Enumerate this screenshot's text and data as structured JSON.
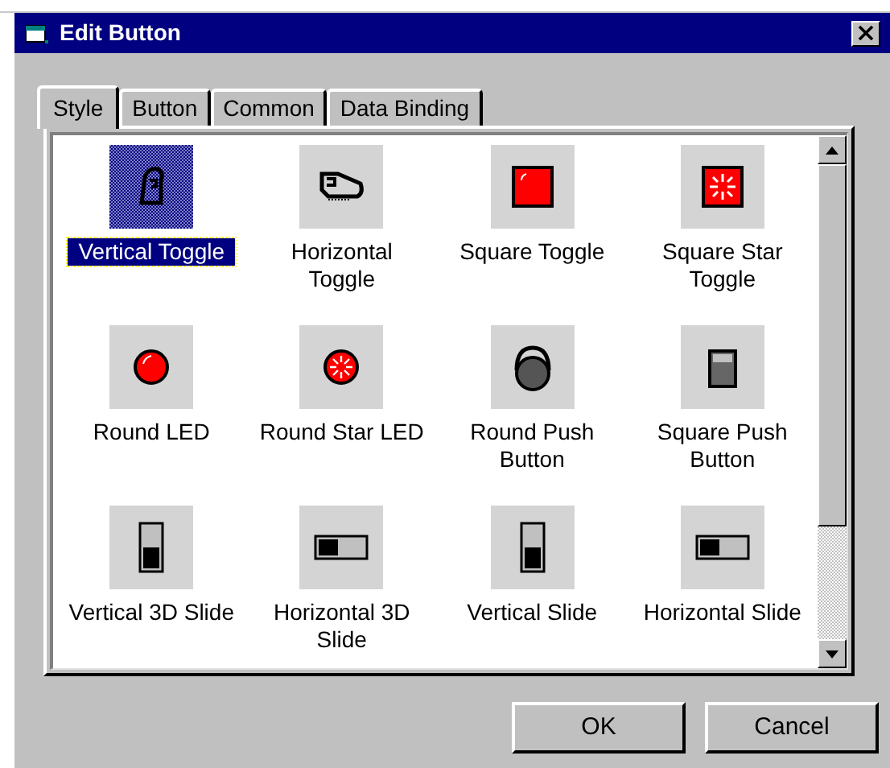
{
  "window": {
    "title": "Edit Button"
  },
  "tabs": [
    {
      "label": "Style",
      "selected": true
    },
    {
      "label": "Button",
      "selected": false
    },
    {
      "label": "Common",
      "selected": false
    },
    {
      "label": "Data Binding",
      "selected": false
    }
  ],
  "styles": [
    {
      "label": "Vertical Toggle",
      "kind": "vtoggle",
      "selected": true
    },
    {
      "label": "Horizontal Toggle",
      "kind": "htoggle",
      "selected": false
    },
    {
      "label": "Square Toggle",
      "kind": "sqtoggle",
      "selected": false
    },
    {
      "label": "Square Star Toggle",
      "kind": "sqstar",
      "selected": false
    },
    {
      "label": "Round LED",
      "kind": "led",
      "selected": false
    },
    {
      "label": "Round Star LED",
      "kind": "starled",
      "selected": false
    },
    {
      "label": "Round Push Button",
      "kind": "roundpush",
      "selected": false
    },
    {
      "label": "Square Push Button",
      "kind": "squarepush",
      "selected": false
    },
    {
      "label": "Vertical 3D Slide",
      "kind": "vslide3d",
      "selected": false
    },
    {
      "label": "Horizontal 3D Slide",
      "kind": "hslide3d",
      "selected": false
    },
    {
      "label": "Vertical Slide",
      "kind": "vslide",
      "selected": false
    },
    {
      "label": "Horizontal Slide",
      "kind": "hslide",
      "selected": false
    }
  ],
  "buttons": [
    "OK",
    "Cancel"
  ]
}
